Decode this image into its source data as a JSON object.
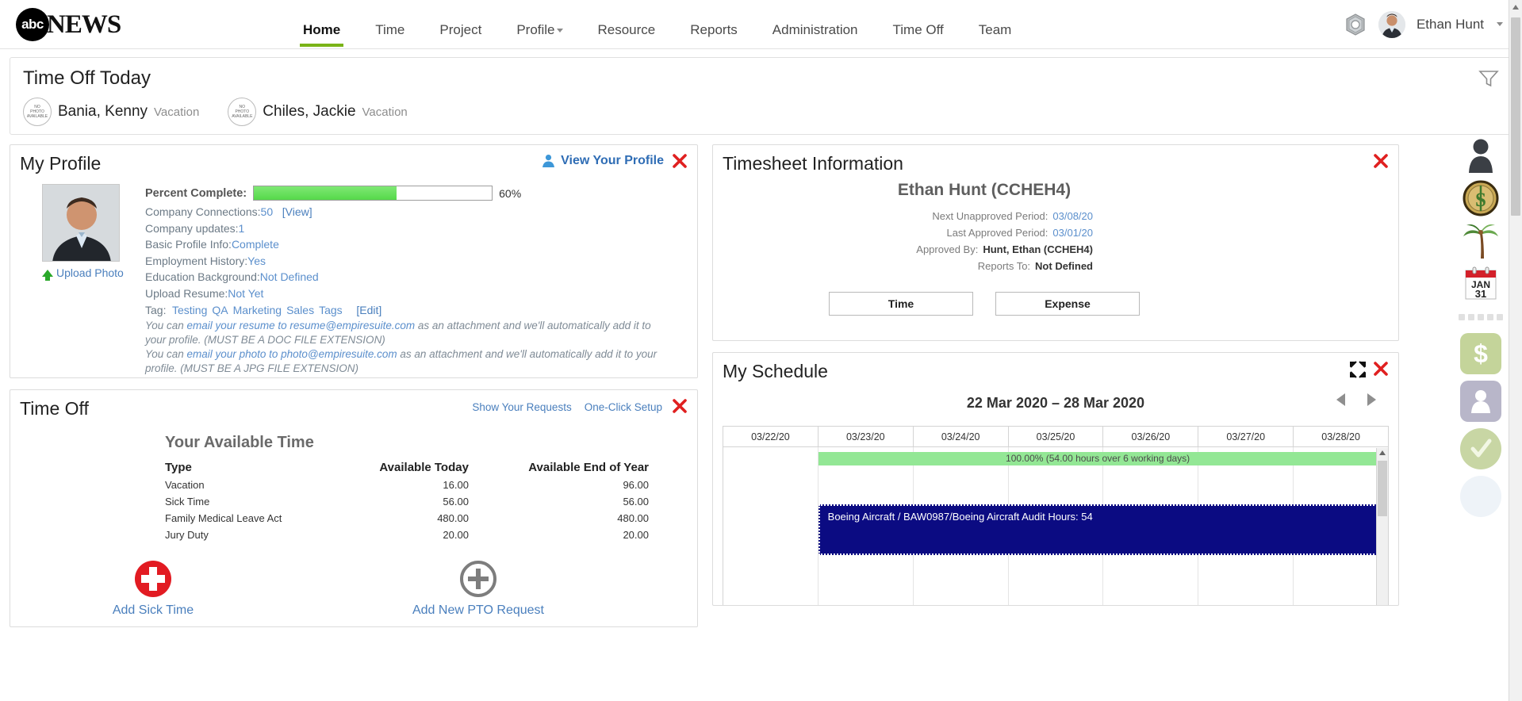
{
  "header": {
    "logo_abc": "abc",
    "logo_news": "NEWS",
    "nav": [
      {
        "label": "Home",
        "active": true,
        "caret": false
      },
      {
        "label": "Time",
        "active": false,
        "caret": false
      },
      {
        "label": "Project",
        "active": false,
        "caret": false
      },
      {
        "label": "Profile",
        "active": false,
        "caret": true
      },
      {
        "label": "Resource",
        "active": false,
        "caret": false
      },
      {
        "label": "Reports",
        "active": false,
        "caret": false
      },
      {
        "label": "Administration",
        "active": false,
        "caret": false
      },
      {
        "label": "Time Off",
        "active": false,
        "caret": false
      },
      {
        "label": "Team",
        "active": false,
        "caret": false
      }
    ],
    "user_name": "Ethan Hunt",
    "settings_icon": "gear-nut-icon",
    "accent_color": "#7ab317"
  },
  "time_off_today": {
    "title": "Time Off Today",
    "nophoto_text": [
      "NO",
      "PHOTO",
      "AVAILABLE"
    ],
    "people": [
      {
        "name": "Bania, Kenny",
        "type": "Vacation"
      },
      {
        "name": "Chiles, Jackie",
        "type": "Vacation"
      }
    ],
    "filter_icon": "filter-funnel-icon"
  },
  "my_profile": {
    "title": "My Profile",
    "view_profile_label": "View Your Profile",
    "upload_photo_label": "Upload Photo",
    "percent_complete_label": "Percent Complete:",
    "percent_complete_value": "60%",
    "percent_complete_fill": 60,
    "fill_color": "#6ee263",
    "lines": [
      {
        "label": "Company Connections:",
        "value": "50",
        "extra": "[View]"
      },
      {
        "label": "Company updates:",
        "value": "1",
        "extra": ""
      },
      {
        "label": "Basic Profile Info:",
        "value": "Complete",
        "extra": ""
      },
      {
        "label": "Employment History:",
        "value": "Yes",
        "extra": ""
      },
      {
        "label": "Education Background:",
        "value": "Not Defined",
        "extra": ""
      },
      {
        "label": "Upload Resume:",
        "value": "Not Yet",
        "extra": ""
      }
    ],
    "tag_label": "Tag:",
    "tags": [
      "Testing",
      "QA",
      "Marketing",
      "Sales",
      "Tags"
    ],
    "tag_edit": "[Edit]",
    "note_resume_pre": "You can ",
    "note_resume_link": "email your resume to resume@empiresuite.com",
    "note_resume_post": " as an attachment and we'll automatically add it to your profile. (MUST BE A DOC FILE EXTENSION)",
    "note_photo_pre": "You can ",
    "note_photo_link": "email your photo to photo@empiresuite.com",
    "note_photo_post": " as an attachment and we'll automatically add it to your profile. (MUST BE A JPG FILE EXTENSION)"
  },
  "time_off": {
    "title": "Time Off",
    "links": [
      "Show Your Requests",
      "One-Click Setup"
    ],
    "table_title": "Your Available Time",
    "columns": [
      "Type",
      "Available Today",
      "Available End of Year"
    ],
    "rows": [
      {
        "type": "Vacation",
        "today": "16.00",
        "eoy": "96.00"
      },
      {
        "type": "Sick Time",
        "today": "56.00",
        "eoy": "56.00"
      },
      {
        "type": "Family Medical Leave Act",
        "today": "480.00",
        "eoy": "480.00"
      },
      {
        "type": "Jury Duty",
        "today": "20.00",
        "eoy": "20.00"
      }
    ],
    "action_sick": "Add Sick Time",
    "action_pto": "Add New PTO Request",
    "sick_icon_color": "#e21b22",
    "pto_icon_color": "#7d7d7d"
  },
  "timesheet": {
    "title": "Timesheet Information",
    "person": "Ethan Hunt (CCHEH4)",
    "rows": [
      {
        "label": "Next Unapproved Period:",
        "value": "03/08/20",
        "style": "blue"
      },
      {
        "label": "Last Approved Period:",
        "value": "03/01/20",
        "style": "blue"
      },
      {
        "label": "Approved By:",
        "value": "Hunt, Ethan (CCHEH4)",
        "style": "dark"
      },
      {
        "label": "Reports To:",
        "value": "Not Defined",
        "style": "dark"
      }
    ],
    "btn_time": "Time",
    "btn_expense": "Expense"
  },
  "schedule": {
    "title": "My Schedule",
    "date_range": "22 Mar 2020 – 28 Mar 2020",
    "expand_icon": "expand-arrows-icon",
    "prev_icon": "prev-arrow-icon",
    "next_icon": "next-arrow-icon",
    "day_headers": [
      "03/22/20",
      "03/23/20",
      "03/24/20",
      "03/25/20",
      "03/26/20",
      "03/27/20",
      "03/28/20"
    ],
    "utilization_bar": "100.00% (54.00 hours over 6 working days)",
    "utilization_color": "#93e795",
    "task_bar": "Boeing Aircraft / BAW0987/Boeing Aircraft Audit Hours: 54",
    "task_color": "#0b0b82"
  },
  "right_rail": {
    "icons": [
      {
        "name": "person-silhouette-icon"
      },
      {
        "name": "gold-coin-dollar-icon"
      },
      {
        "name": "palm-tree-icon"
      },
      {
        "name": "calendar-jan-31-icon",
        "month": "JAN",
        "day": "31"
      }
    ],
    "tiles": [
      {
        "name": "dollar-tile-icon",
        "glyph": "$"
      },
      {
        "name": "person-tile-icon",
        "glyph": ""
      },
      {
        "name": "check-tile-icon",
        "glyph": "✓"
      },
      {
        "name": "blank-tile-icon",
        "glyph": ""
      }
    ]
  }
}
